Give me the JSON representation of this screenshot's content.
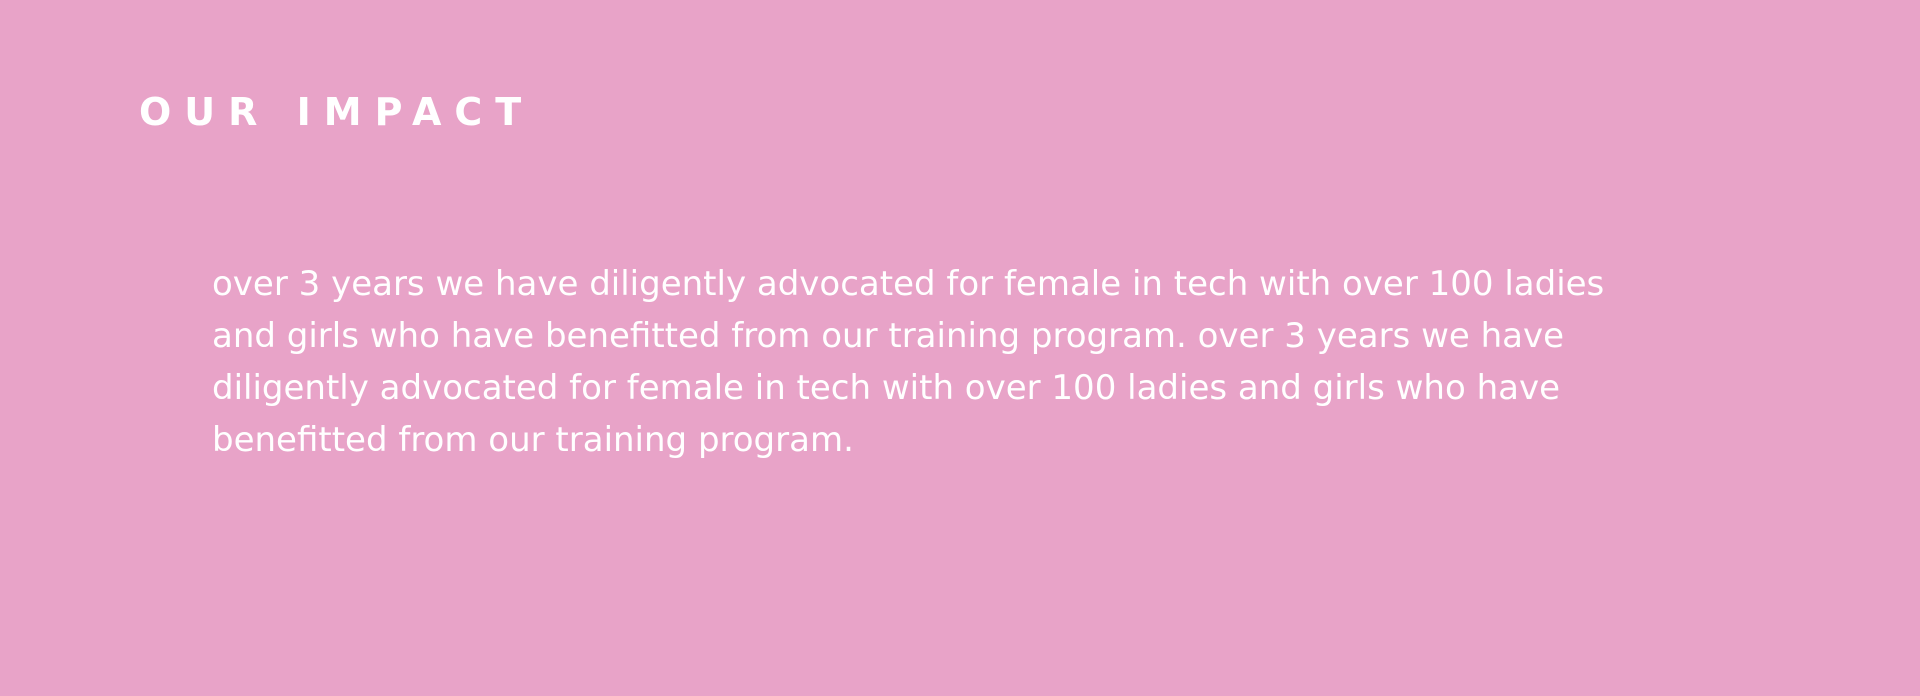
{
  "theme": {
    "background": "#e8a3c8",
    "text": "#ffffff"
  },
  "section": {
    "heading": "OUR IMPACT",
    "body_lines": [
      "over 3 years we have diligently advocated for female in tech with over 100 ladies",
      "and girls who have benefitted from our training program. over 3 years we have",
      "diligently advocated for female in tech with over 100 ladies and girls who have",
      "benefitted from our training program."
    ]
  }
}
